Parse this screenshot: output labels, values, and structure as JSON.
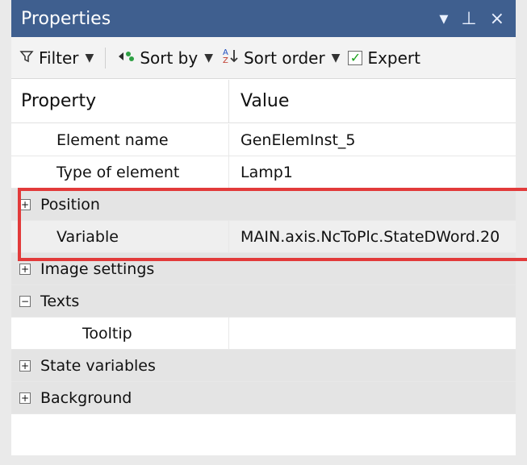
{
  "titlebar": {
    "title": "Properties",
    "controls": {
      "menu": "▾",
      "pin": "⊥",
      "close": "×"
    }
  },
  "toolbar": {
    "filter_label": "Filter",
    "sortby_label": "Sort by",
    "sortorder_label": "Sort order",
    "expert_label": "Expert",
    "expert_checked": true,
    "icons": {
      "filter": "filter-icon",
      "sortby": "sort-by-icon",
      "sortorder": "sort-order-icon",
      "dropdown": "chevron-down-icon"
    }
  },
  "grid": {
    "headers": [
      "Property",
      "Value"
    ],
    "rows": [
      {
        "type": "property",
        "label": "Element name",
        "value": "GenElemInst_5",
        "indent": 1
      },
      {
        "type": "property",
        "label": "Type of element",
        "value": "Lamp1",
        "indent": 1
      },
      {
        "type": "category",
        "label": "Position",
        "expander": "+",
        "value": ""
      },
      {
        "type": "property",
        "label": "Variable",
        "value": "MAIN.axis.NcToPlc.StateDWord.20",
        "indent": 1,
        "highlight": true
      },
      {
        "type": "category",
        "label": "Image settings",
        "expander": "+",
        "value": ""
      },
      {
        "type": "category",
        "label": "Texts",
        "expander": "−",
        "value": ""
      },
      {
        "type": "property",
        "label": "Tooltip",
        "value": "",
        "indent": 2
      },
      {
        "type": "category",
        "label": "State variables",
        "expander": "+",
        "value": ""
      },
      {
        "type": "category",
        "label": "Background",
        "expander": "+",
        "value": ""
      }
    ]
  },
  "colors": {
    "titlebar": "#3f5f8f",
    "highlight_border": "#e23a3a",
    "category_bg": "#e4e4e4"
  }
}
